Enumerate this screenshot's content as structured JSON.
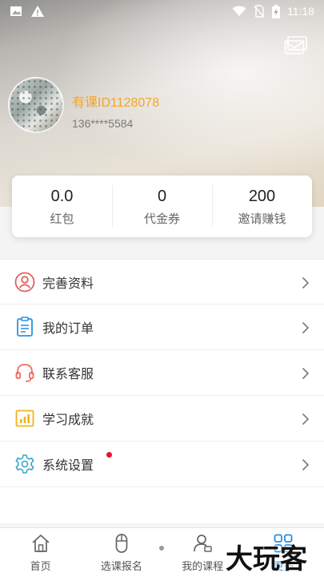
{
  "status_bar": {
    "time": "11:18"
  },
  "profile": {
    "username": "有课ID1128078",
    "phone": "136****5584"
  },
  "stats": [
    {
      "value": "0.0",
      "label": "红包"
    },
    {
      "value": "0",
      "label": "代金券"
    },
    {
      "value": "200",
      "label": "邀请赚钱"
    }
  ],
  "menu": {
    "items": [
      {
        "label": "完善资料",
        "icon": "profile-edit-icon",
        "color": "#e06161"
      },
      {
        "label": "我的订单",
        "icon": "order-list-icon",
        "color": "#2b94df"
      },
      {
        "label": "联系客服",
        "icon": "headset-icon",
        "color": "#f06a5a"
      },
      {
        "label": "学习成就",
        "icon": "chart-icon",
        "color": "#f0b41d"
      },
      {
        "label": "系统设置",
        "icon": "gear-icon",
        "color": "#3aa6c9",
        "badge": true
      }
    ]
  },
  "tabbar": {
    "items": [
      {
        "label": "首页",
        "icon": "home-icon"
      },
      {
        "label": "选课报名",
        "icon": "mouse-icon"
      },
      {
        "label": "我的课程",
        "icon": "user-course-icon"
      },
      {
        "label": "更多",
        "icon": "grid-icon",
        "active": true
      }
    ]
  },
  "watermark": "大玩客",
  "colors": {
    "accent": "#2a8de0",
    "username": "#f5a524",
    "badge": "#e8132a"
  }
}
